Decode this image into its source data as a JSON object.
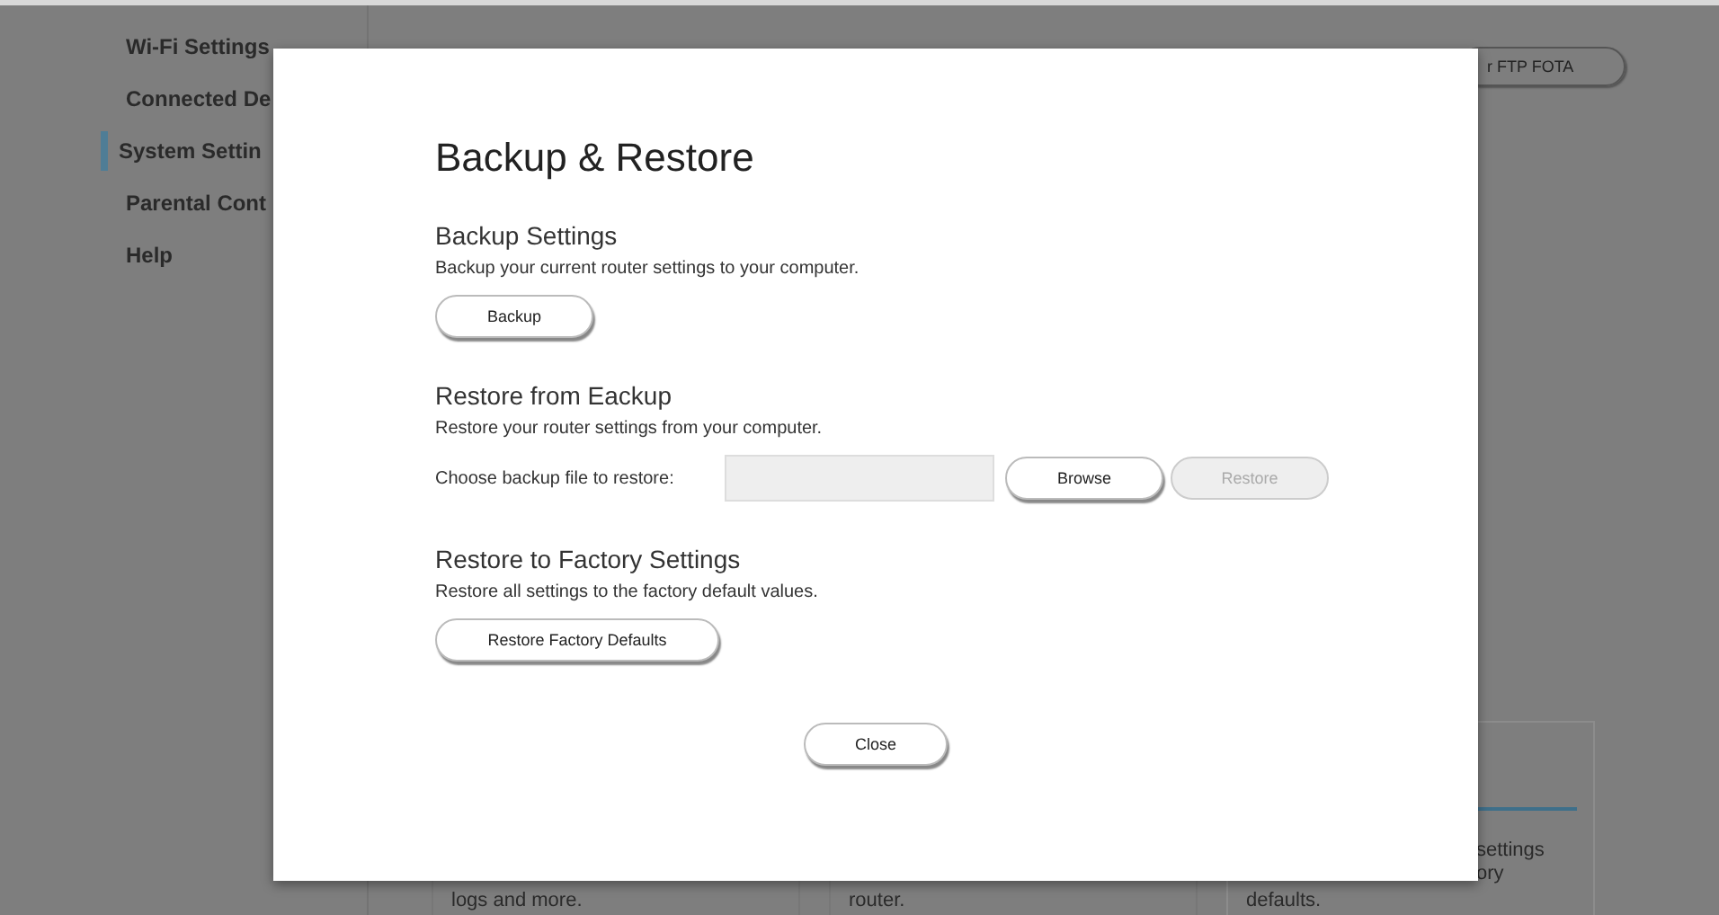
{
  "sidebar": {
    "items": [
      {
        "label": "Wi-Fi Settings",
        "selected": false
      },
      {
        "label": "Connected De",
        "selected": false
      },
      {
        "label": "System Settin",
        "selected": true
      },
      {
        "label": "Parental Cont",
        "selected": false
      },
      {
        "label": "Help",
        "selected": false
      }
    ]
  },
  "top_button": {
    "label": "r FTP FOTA"
  },
  "cards": [
    {
      "lines": [
        "logs and more."
      ]
    },
    {
      "lines": [
        "router."
      ]
    },
    {
      "side_lines": [
        "settings",
        "ory"
      ],
      "lines": [
        "defaults."
      ]
    }
  ],
  "dialog": {
    "title": "Backup & Restore",
    "sections": [
      {
        "kind": "button",
        "heading": "Backup Settings",
        "description": "Backup your current router settings to your computer.",
        "button": {
          "label": "Backup",
          "disabled": false
        }
      },
      {
        "kind": "file",
        "heading": "Restore from Eackup",
        "description": "Restore your router settings from your computer.",
        "field_label": "Choose backup file to restore:",
        "buttons": [
          {
            "label": "Browse",
            "disabled": false
          },
          {
            "label": "Restore",
            "disabled": true
          }
        ]
      },
      {
        "kind": "button",
        "heading": "Restore to Factory Settings",
        "description": "Restore all settings to the factory default values.",
        "button": {
          "label": "Restore Factory Defaults",
          "disabled": false
        }
      }
    ],
    "close": {
      "label": "Close"
    }
  }
}
